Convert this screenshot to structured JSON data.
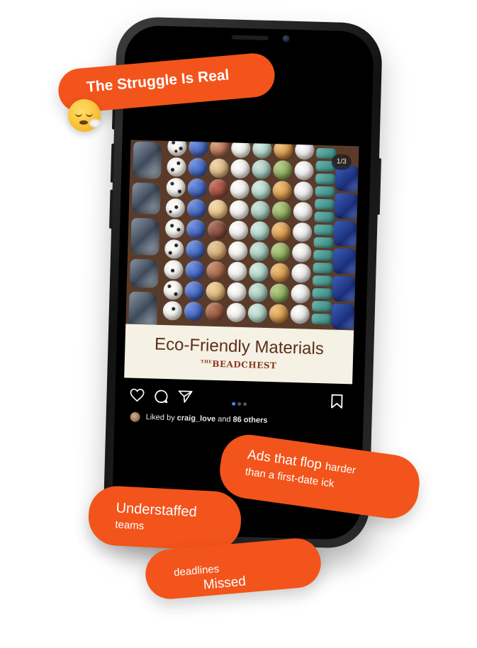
{
  "banner": {
    "headline": "The Struggle Is Real",
    "emoji_icon": "exhale-emoji-icon"
  },
  "post": {
    "image_counter": "1/3",
    "caption_title": "Eco-Friendly Materials",
    "brand_top": "THE",
    "brand_name": "BEADCHEST",
    "likes": {
      "prefix": "Liked by",
      "user": "craig_love",
      "middle": "and",
      "others": "86 others"
    },
    "carousel": {
      "total": 3,
      "active": 1
    },
    "actions": [
      "heart-icon",
      "comment-icon",
      "share-icon",
      "bookmark-icon"
    ]
  },
  "callouts": {
    "ads": {
      "big": "Ads that flop",
      "small_inline": "harder",
      "line2": "than a first-date ick"
    },
    "staff": {
      "line1": "Understaffed",
      "line2": "teams"
    },
    "deadlines": {
      "big": "Missed",
      "small": "deadlines"
    }
  },
  "colors": {
    "accent": "#f2541b",
    "caption_bg": "#f5f1e4",
    "caption_text": "#5b2d1b",
    "active_dot": "#3b8cf0"
  }
}
